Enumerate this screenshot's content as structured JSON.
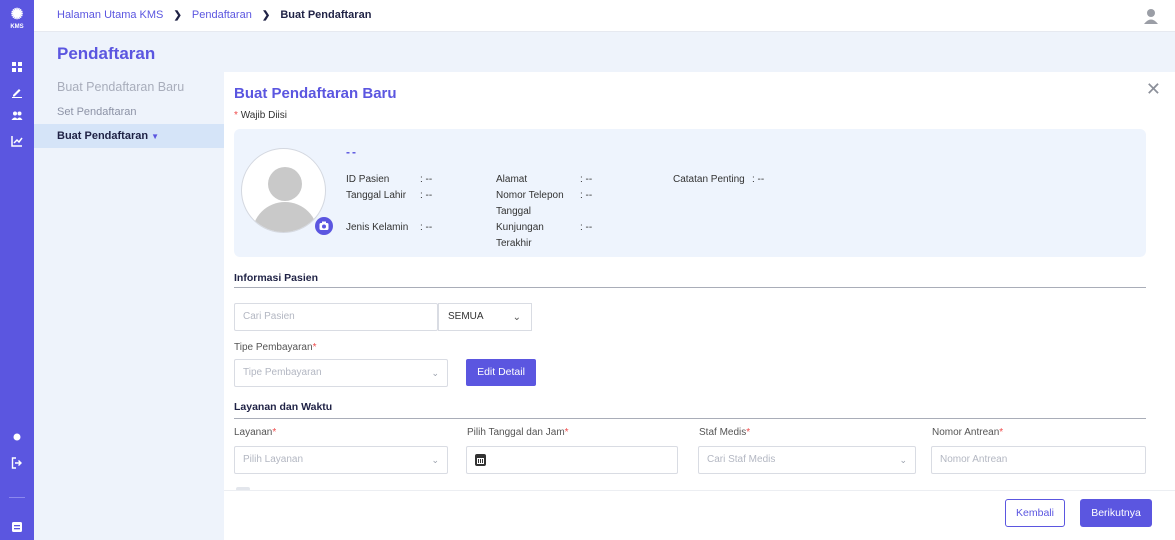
{
  "rail": {
    "logo_text": "KMS",
    "icons": [
      "dashboard-icon",
      "edit-icon",
      "people-icon",
      "chart-icon",
      "dot-icon",
      "logout-icon",
      "grid-icon"
    ]
  },
  "breadcrumb": {
    "home": "Halaman Utama KMS",
    "registration": "Pendaftaran",
    "current": "Buat Pendaftaran",
    "separator": "❯"
  },
  "subnav": {
    "title": "Pendaftaran",
    "items": [
      {
        "label": "Buat Pendaftaran Baru"
      },
      {
        "label": "Set Pendaftaran"
      },
      {
        "label": "Buat Pendaftaran",
        "marker": "▼"
      }
    ]
  },
  "panel": {
    "title": "Buat Pendaftaran Baru",
    "close_symbol": "✕",
    "required_star": "*",
    "required_note": "Wajib Diisi"
  },
  "patient_card": {
    "name": "--",
    "fields": {
      "id_label": "ID Pasien",
      "id_value": ": --",
      "dob_label": "Tanggal Lahir",
      "dob_value": ": --",
      "gender_label": "Jenis Kelamin",
      "gender_value": ": --",
      "address_label": "Alamat",
      "address_value": ": --",
      "phone_label": "Nomor Telepon",
      "phone_value": ": --",
      "lastvisit_label_1": "Tanggal",
      "lastvisit_label_2": "Kunjungan",
      "lastvisit_label_3": "Terakhir",
      "lastvisit_value": ": --",
      "notes_label": "Catatan Penting",
      "notes_value": ": --"
    }
  },
  "patient_info": {
    "heading": "Informasi Pasien",
    "search_placeholder": "Cari Pasien",
    "filter_value": "SEMUA",
    "payment_label": "Tipe Pembayaran",
    "payment_placeholder": "Tipe Pembayaran",
    "edit_button": "Edit Detail"
  },
  "service": {
    "heading": "Layanan dan Waktu",
    "service_label": "Layanan",
    "service_placeholder": "Pilih Layanan",
    "datetime_label": "Pilih Tanggal dan Jam",
    "staff_label": "Staf Medis",
    "staff_placeholder": "Cari Staf Medis",
    "queue_label": "Nomor Antrean",
    "queue_placeholder": "Nomor Antrean"
  },
  "footer": {
    "back_button": "Kembali",
    "next_button": "Berikutnya"
  },
  "colors": {
    "accent": "#5b56e0",
    "active_nav_bg": "#d5e4f8",
    "required": "#ef4b4b"
  }
}
